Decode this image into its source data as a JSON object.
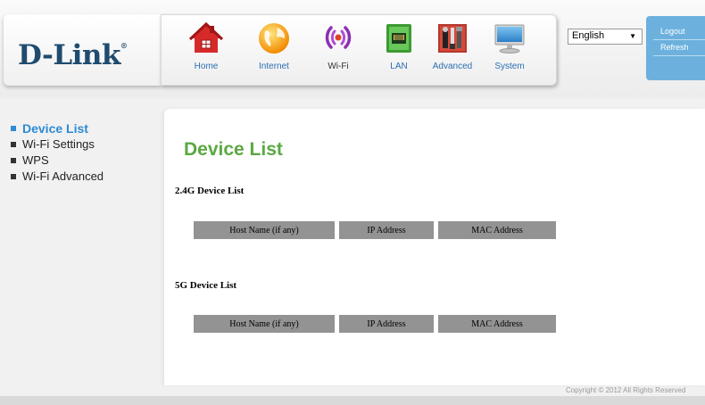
{
  "brand": {
    "logo_text": "D-Link",
    "logo_mark": "®"
  },
  "nav": {
    "items": [
      {
        "label": "Home",
        "icon": "home-icon"
      },
      {
        "label": "Internet",
        "icon": "globe-icon"
      },
      {
        "label": "Wi-Fi",
        "icon": "wifi-icon"
      },
      {
        "label": "LAN",
        "icon": "lan-port-icon"
      },
      {
        "label": "Advanced",
        "icon": "tools-icon"
      },
      {
        "label": "System",
        "icon": "computer-icon"
      }
    ],
    "active": "Wi-Fi"
  },
  "language": {
    "selected": "English"
  },
  "actions": {
    "logout": "Logout",
    "refresh": "Refresh"
  },
  "sidebar": {
    "items": [
      {
        "label": "Device List",
        "active": true
      },
      {
        "label": "Wi-Fi Settings"
      },
      {
        "label": "WPS"
      },
      {
        "label": "Wi-Fi Advanced"
      }
    ]
  },
  "main": {
    "title": "Device List",
    "sections": [
      {
        "title": "2.4G Device List",
        "columns": [
          "Host Name (if any)",
          "IP Address",
          "MAC Address"
        ]
      },
      {
        "title": "5G Device List",
        "columns": [
          "Host Name (if any)",
          "IP Address",
          "MAC Address"
        ]
      }
    ]
  },
  "footer": {
    "copyright": "Copyright © 2012  All Rights Reserved"
  },
  "colors": {
    "accent_green": "#5ba842",
    "link_blue": "#2b8bd4",
    "brand_navy": "#1f4b6e",
    "action_panel": "#6cb1dd",
    "table_header": "#939393"
  }
}
